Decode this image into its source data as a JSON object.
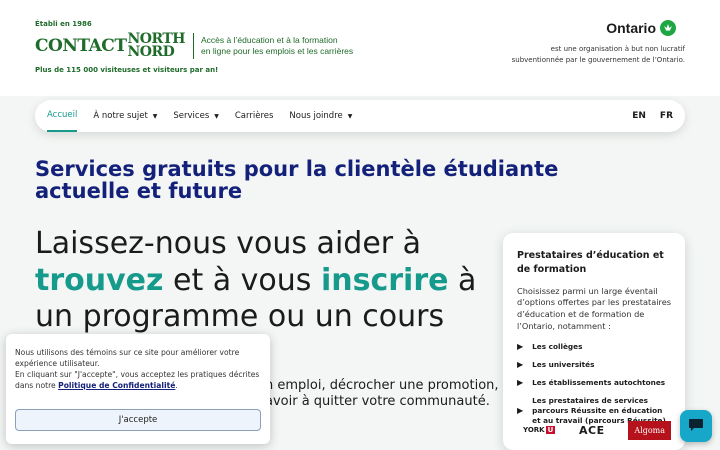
{
  "header": {
    "established": "Établi en 1986",
    "logo": {
      "word1": "CONTACT",
      "word2": "NORTH",
      "word3": "NORD",
      "tagline_line1": "Accès à l’éducation et à la formation",
      "tagline_line2": "en ligne pour les emplois et les carrières"
    },
    "visitors": "Plus de 115 000 visiteuses et visiteurs par an!",
    "ontario": {
      "label": "Ontario",
      "desc_line1": "est une organisation à but non lucratif",
      "desc_line2": "subventionnée par le gouvernement de l’Ontario."
    }
  },
  "nav": {
    "items": [
      {
        "label": "Accueil",
        "active": true
      },
      {
        "label": "À notre sujet",
        "dropdown": true
      },
      {
        "label": "Services",
        "dropdown": true
      },
      {
        "label": "Carrières"
      },
      {
        "label": "Nous joindre",
        "dropdown": true
      }
    ],
    "languages": [
      "EN",
      "FR"
    ]
  },
  "hero": {
    "title": "Services gratuits pour la clientèle étudiante actuelle et future",
    "line1": "Laissez-nous vous aider à",
    "word_find": "trouvez",
    "mid": " et à vous ",
    "word_enroll": "inscrire",
    "tail": " à",
    "line3": "un programme ou un cours",
    "partial_line1": "n emploi, décrocher une promotion,",
    "partial_line2": "avoir à quitter votre communauté."
  },
  "card": {
    "title": "Prestataires d’éducation et de formation",
    "desc": "Choisissez parmi un large éventail d’options offertes par les prestataires d’éducation et de formation de l’Ontario, notamment :",
    "items": [
      "Les collèges",
      "Les universités",
      "Les établissements autochtones",
      "Les prestataires de services parcours Réussite en éducation et au travail (parcours Réussite)"
    ],
    "partners": {
      "york": "YORK",
      "york_u": "U",
      "ace": "ACE",
      "algoma": "Algoma"
    }
  },
  "cookie": {
    "text1": "Nous utilisons des témoins sur ce site pour améliorer votre expérience utilisateur.",
    "text2_prefix": "En cliquant sur \"J'accepte\", vous acceptez les pratiques décrites dans notre ",
    "link": "Politique de Confidentialité",
    "text2_suffix": ".",
    "accept": "J'accepte"
  },
  "colors": {
    "brand_green": "#1f6b2a",
    "teal": "#159a8c",
    "navy": "#14217a",
    "chat": "#16a7c9"
  },
  "icons": [
    "caret-down-icon",
    "trillium-icon",
    "play-bullet-icon",
    "chat-icon"
  ]
}
